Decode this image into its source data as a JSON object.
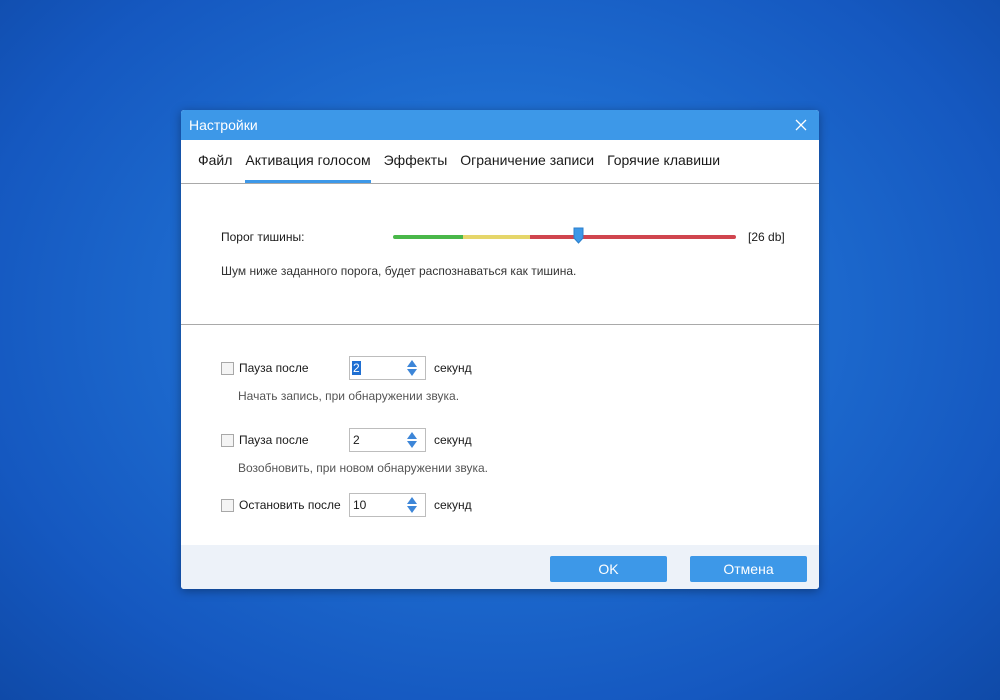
{
  "dialog": {
    "title": "Настройки",
    "close_icon": "close-icon"
  },
  "tabs": [
    {
      "label": "Файл",
      "active": false
    },
    {
      "label": "Активация голосом",
      "active": true
    },
    {
      "label": "Эффекты",
      "active": false
    },
    {
      "label": "Ограничение записи",
      "active": false
    },
    {
      "label": "Горячие клавиши",
      "active": false
    }
  ],
  "threshold": {
    "label": "Порог тишины:",
    "value_text": "[26 db]",
    "level": 0.54,
    "hint": "Шум ниже заданного порога, будет распознаваться как тишина.",
    "colors": {
      "green": "#49b749",
      "yellow": "#e5d66a",
      "red": "#d0454e",
      "handle": "#3d98e8"
    }
  },
  "options": {
    "pause_start": {
      "label": "Пауза после",
      "value": "2",
      "unit": "секунд",
      "hint": "Начать запись, при обнаружении звука.",
      "checked": false
    },
    "pause_resume": {
      "label": "Пауза после",
      "value": "2",
      "unit": "секунд",
      "hint": "Возобновить, при новом обнаружении звука.",
      "checked": false
    },
    "stop_after": {
      "label": "Остановить после",
      "value": "10",
      "unit": "секунд",
      "checked": false
    }
  },
  "buttons": {
    "ok": "OK",
    "cancel": "Отмена"
  },
  "colors": {
    "accent": "#3d98e8",
    "footer_bg": "#edf2f9"
  }
}
